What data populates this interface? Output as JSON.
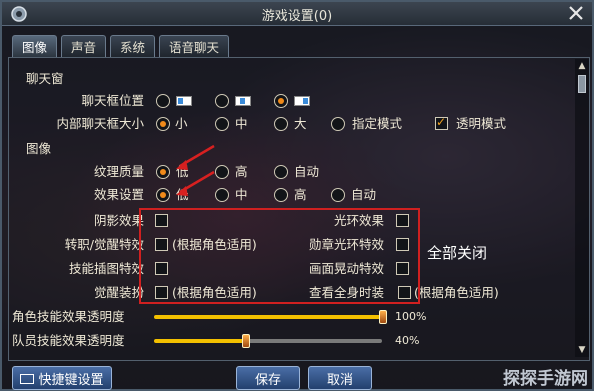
{
  "window": {
    "title": "游戏设置(0)"
  },
  "tabs": [
    {
      "label": "图像",
      "active": true
    },
    {
      "label": "声音",
      "active": false
    },
    {
      "label": "系统",
      "active": false
    },
    {
      "label": "语音聊天",
      "active": false
    }
  ],
  "chat_section": {
    "header": "聊天窗",
    "position": {
      "label": "聊天框位置",
      "options": [
        "left",
        "middle",
        "right"
      ],
      "selected": 2
    },
    "size": {
      "label": "内部聊天框大小",
      "options": [
        "小",
        "中",
        "大",
        "指定模式"
      ],
      "selected": 0,
      "transparent_label": "透明模式",
      "transparent_checked": true
    }
  },
  "image_section": {
    "header": "图像",
    "texture": {
      "label": "纹理质量",
      "options": [
        "低",
        "高",
        "自动"
      ],
      "selected": 0
    },
    "effects": {
      "label": "效果设置",
      "options": [
        "低",
        "中",
        "高",
        "自动"
      ],
      "selected": 0
    }
  },
  "effect_toggles": {
    "left": [
      {
        "label": "阴影效果",
        "checked": false
      },
      {
        "label": "转职/觉醒特效",
        "suffix": "(根据角色适用)",
        "checked": false
      },
      {
        "label": "技能插图特效",
        "checked": false
      },
      {
        "label": "觉醒装扮",
        "suffix": "(根据角色适用)",
        "checked": false
      }
    ],
    "right": [
      {
        "label": "光环效果",
        "checked": false
      },
      {
        "label": "勋章光环特效",
        "checked": false
      },
      {
        "label": "画面晃动特效",
        "checked": false
      },
      {
        "label": "查看全身时装",
        "suffix": "(根据角色适用)",
        "checked": false
      }
    ],
    "note": "全部关闭"
  },
  "sliders": [
    {
      "label": "角色技能效果透明度",
      "value_text": "100%",
      "value": 100
    },
    {
      "label": "队员技能效果透明度",
      "value_text": "40%",
      "value": 40
    }
  ],
  "footer": {
    "shortcut_label": "快捷键设置",
    "save_label": "保存",
    "cancel_label": "取消"
  },
  "watermark": "探探手游网",
  "colors": {
    "accent": "#f08a1a",
    "highlight": "#d02020",
    "slider": "#f3c000"
  }
}
